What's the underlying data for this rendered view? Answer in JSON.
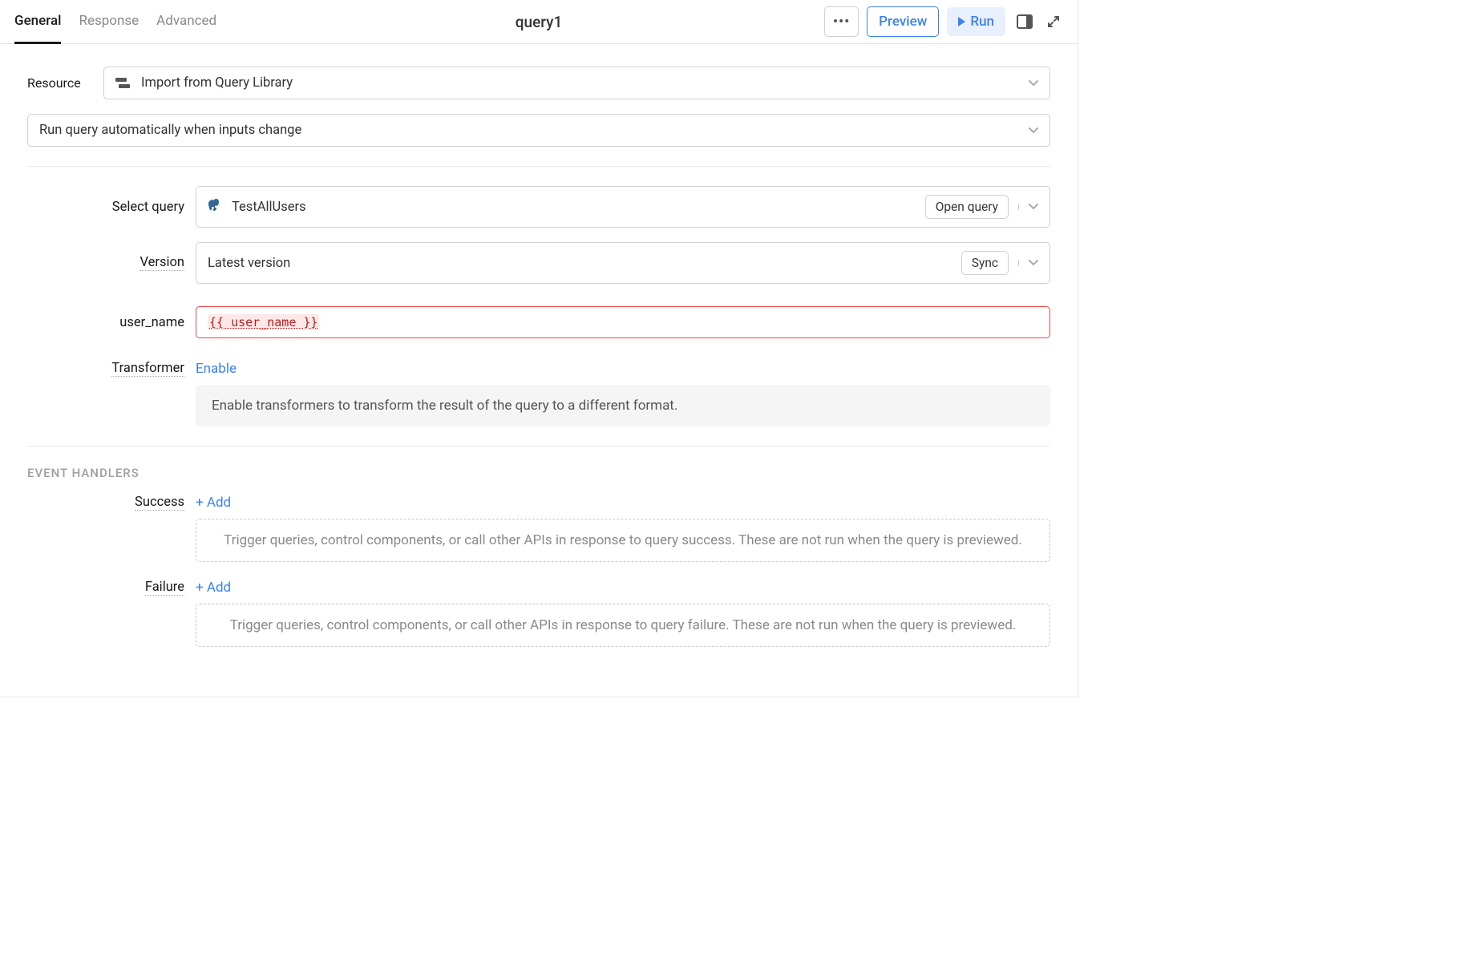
{
  "header": {
    "tabs": [
      "General",
      "Response",
      "Advanced"
    ],
    "query_name": "query1",
    "more_label": "•••",
    "preview_label": "Preview",
    "run_label": "Run"
  },
  "resource": {
    "label": "Resource",
    "value": "Import from Query Library"
  },
  "run_behavior": {
    "value": "Run query automatically when inputs change"
  },
  "select_query": {
    "label": "Select query",
    "value": "TestAllUsers",
    "open_label": "Open query"
  },
  "version": {
    "label": "Version",
    "value": "Latest version",
    "sync_label": "Sync"
  },
  "param": {
    "label": "user_name",
    "value": "{{ user_name }}"
  },
  "transformer": {
    "label": "Transformer",
    "enable_label": "Enable",
    "description": "Enable transformers to transform the result of the query to a different format."
  },
  "events": {
    "section_title": "EVENT HANDLERS",
    "success": {
      "label": "Success",
      "add_label": "+ Add",
      "description": "Trigger queries, control components, or call other APIs in response to query success. These are not run when the query is previewed."
    },
    "failure": {
      "label": "Failure",
      "add_label": "+ Add",
      "description": "Trigger queries, control components, or call other APIs in response to query failure. These are not run when the query is previewed."
    }
  }
}
